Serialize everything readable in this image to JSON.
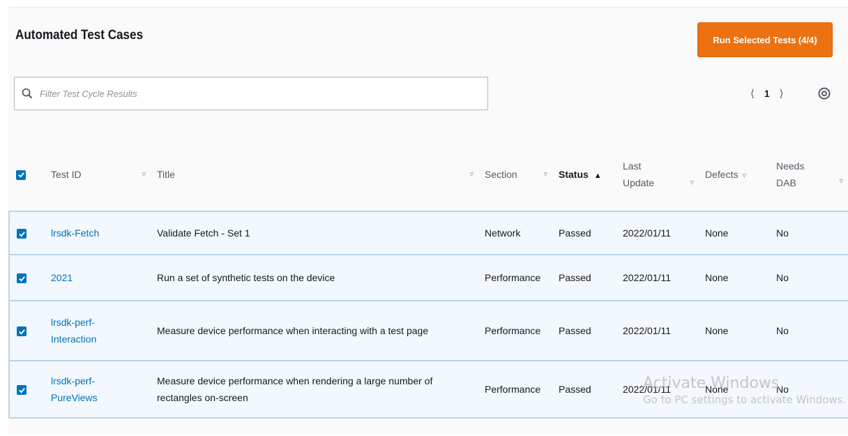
{
  "header": {
    "title": "Automated Test Cases",
    "run_button_label": "Run Selected Tests (4/4)"
  },
  "search": {
    "placeholder": "Filter Test Cycle Results",
    "icon": "search-icon"
  },
  "pagination": {
    "prev": "⟨",
    "page": "1",
    "next": "⟩",
    "settings_icon": "gear-icon"
  },
  "table": {
    "columns": {
      "test_id": "Test ID",
      "title": "Title",
      "section": "Section",
      "status": "Status",
      "last_update_1": "Last",
      "last_update_2": "Update",
      "defects": "Defects",
      "needs_dab_1": "Needs",
      "needs_dab_2": "DAB"
    },
    "status_sort_indicator": "▲",
    "filter_indicator": "▿",
    "rows": [
      {
        "id": "lrsdk-Fetch",
        "title": "Validate Fetch - Set 1",
        "section": "Network",
        "status": "Passed",
        "last_update": "2022/01/11",
        "defects": "None",
        "needs_dab": "No",
        "checked": true
      },
      {
        "id": "2021",
        "title": "Run a set of synthetic tests on the device",
        "section": "Performance",
        "status": "Passed",
        "last_update": "2022/01/11",
        "defects": "None",
        "needs_dab": "No",
        "checked": true
      },
      {
        "id_1": "lrsdk-perf-",
        "id_2": "Interaction",
        "title": "Measure device performance when interacting with a test page",
        "section": "Performance",
        "status": "Passed",
        "last_update": "2022/01/11",
        "defects": "None",
        "needs_dab": "No",
        "checked": true
      },
      {
        "id_1": "lrsdk-perf-",
        "id_2": "PureViews",
        "title_1": "Measure device performance when rendering a large number of",
        "title_2": "rectangles on-screen",
        "section": "Performance",
        "status": "Passed",
        "last_update": "2022/01/11",
        "defects": "None",
        "needs_dab": "No",
        "checked": true
      }
    ]
  },
  "watermark": {
    "line1": "Activate Windows",
    "line2": "Go to PC settings to activate Windows."
  },
  "colors": {
    "accent_orange": "#ec7211",
    "link_blue": "#0073bb",
    "selected_row_bg": "#f2f8fd",
    "selected_row_border": "#b7d6e8"
  }
}
